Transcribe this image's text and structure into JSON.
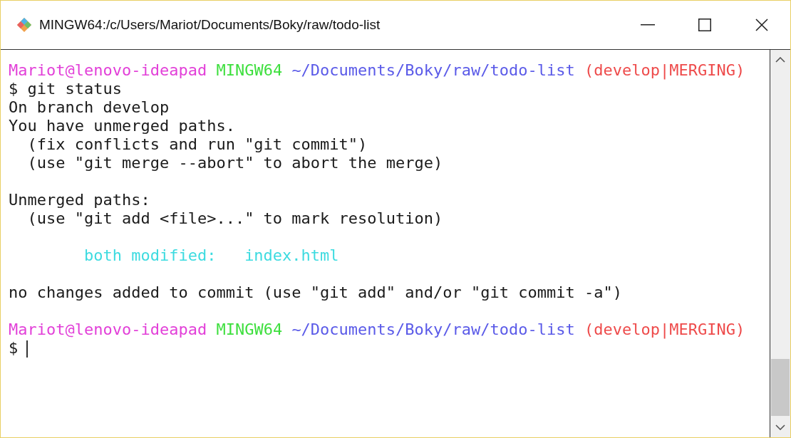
{
  "window": {
    "title": "MINGW64:/c/Users/Mariot/Documents/Boky/raw/todo-list"
  },
  "lines": [
    {
      "kind": "prompt",
      "user": "Mariot@lenovo-ideapad",
      "system": "MINGW64",
      "path": "~/Documents/Boky/raw/todo-list",
      "branch": "(develop|MERGING)"
    },
    {
      "kind": "text",
      "text": "$ git status"
    },
    {
      "kind": "text",
      "text": "On branch develop"
    },
    {
      "kind": "text",
      "text": "You have unmerged paths."
    },
    {
      "kind": "text",
      "text": "  (fix conflicts and run \"git commit\")"
    },
    {
      "kind": "text",
      "text": "  (use \"git merge --abort\" to abort the merge)"
    },
    {
      "kind": "blank"
    },
    {
      "kind": "text",
      "text": "Unmerged paths:"
    },
    {
      "kind": "text",
      "text": "  (use \"git add <file>...\" to mark resolution)"
    },
    {
      "kind": "blank"
    },
    {
      "kind": "modified",
      "text": "        both modified:   index.html"
    },
    {
      "kind": "blank"
    },
    {
      "kind": "text",
      "text": "no changes added to commit (use \"git add\" and/or \"git commit -a\")"
    },
    {
      "kind": "blank"
    },
    {
      "kind": "prompt",
      "user": "Mariot@lenovo-ideapad",
      "system": "MINGW64",
      "path": "~/Documents/Boky/raw/todo-list",
      "branch": "(develop|MERGING)"
    },
    {
      "kind": "input",
      "text": "$"
    }
  ]
}
